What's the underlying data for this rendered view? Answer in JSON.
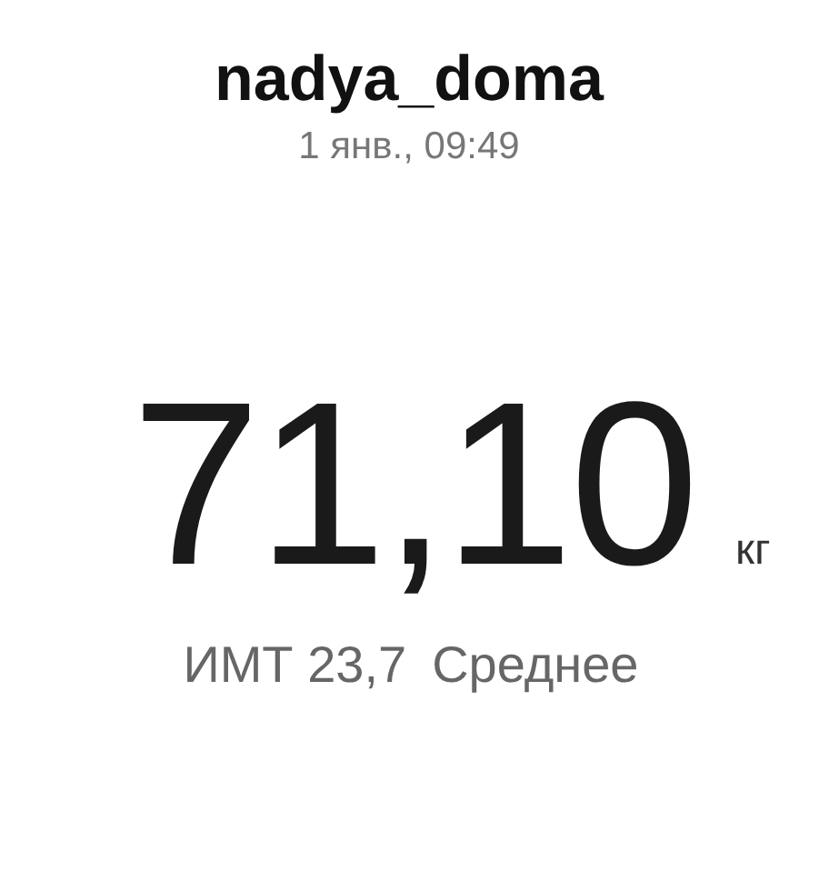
{
  "header": {
    "username": "nadya_doma",
    "date": "1 янв., 09:49"
  },
  "weight": {
    "value": "71,10",
    "unit": "кг"
  },
  "bmi": {
    "label": "ИМТ 23,7",
    "category": "Среднее"
  }
}
